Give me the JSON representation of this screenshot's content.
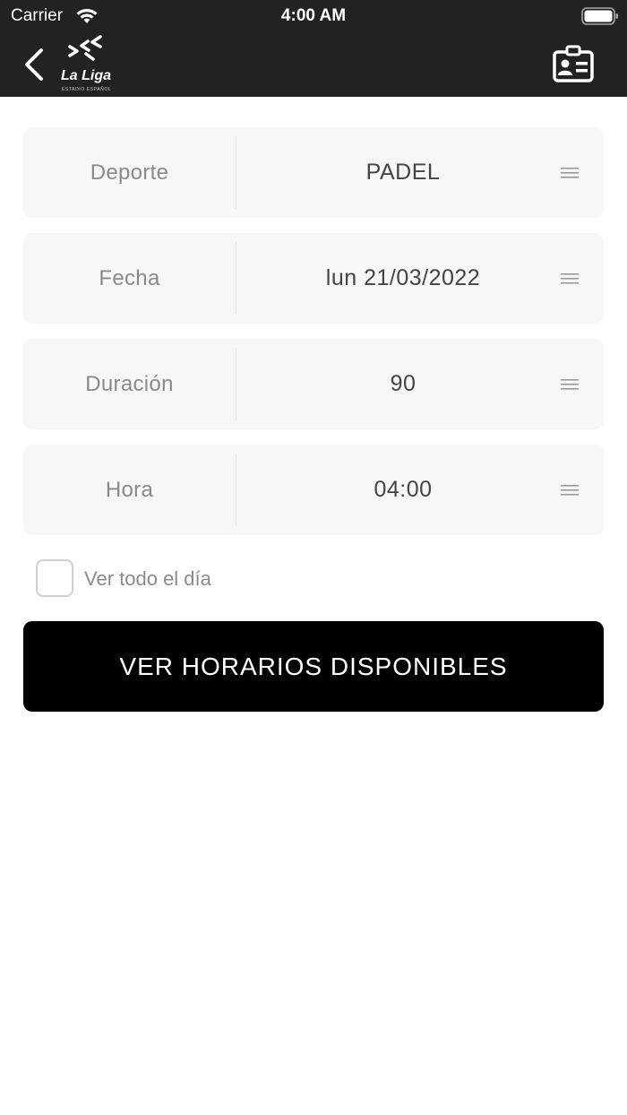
{
  "status_bar": {
    "carrier": "Carrier",
    "time": "4:00 AM",
    "wifi_icon": "wifi-icon",
    "battery_icon": "battery-full-icon"
  },
  "nav_bar": {
    "back_icon": "chevron-left-icon",
    "logo_text": "La Liga",
    "logo_subtext": "ESTADIO ESPAÑOL",
    "right_icon": "id-card-icon"
  },
  "form": {
    "fields": [
      {
        "label": "Deporte",
        "value": "PADEL",
        "icon": "menu-icon"
      },
      {
        "label": "Fecha",
        "value": "lun 21/03/2022",
        "icon": "menu-icon"
      },
      {
        "label": "Duración",
        "value": "90",
        "icon": "menu-icon"
      },
      {
        "label": "Hora",
        "value": "04:00",
        "icon": "menu-icon"
      }
    ],
    "checkbox_label": "Ver todo el día",
    "checkbox_checked": false,
    "submit_label": "VER HORARIOS DISPONIBLES"
  },
  "colors": {
    "header_bg": "#222222",
    "field_bg": "#f7f7f7",
    "button_bg": "#000000",
    "label_text": "#8a8a8a",
    "value_text": "#444444"
  }
}
